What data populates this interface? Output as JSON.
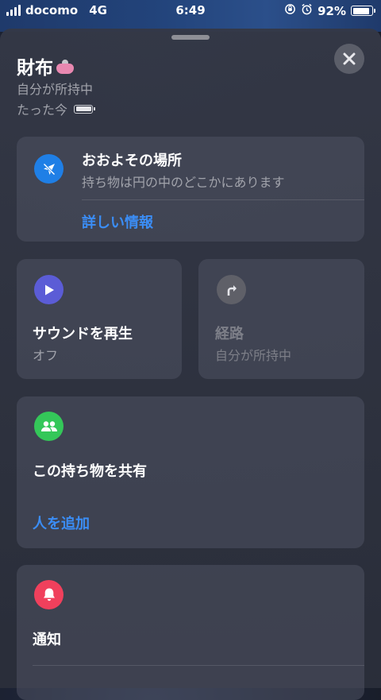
{
  "status_bar": {
    "carrier": "docomo",
    "network": "4G",
    "time": "6:49",
    "battery_percent": "92%",
    "battery_level": 0.92
  },
  "header": {
    "title": "財布",
    "subtitle": "自分が所持中",
    "updated": "たった今"
  },
  "location_card": {
    "title": "おおよその場所",
    "description": "持ち物は円の中のどこかにあります",
    "link": "詳しい情報"
  },
  "sound_card": {
    "title": "サウンドを再生",
    "status": "オフ"
  },
  "directions_card": {
    "title": "経路",
    "status": "自分が所持中"
  },
  "share_card": {
    "title": "この持ち物を共有",
    "link": "人を追加"
  },
  "notify_card": {
    "title": "通知"
  },
  "colors": {
    "accent": "#3b8df5",
    "location_icon": "#1f7fe6",
    "sound_icon": "#5b5cd6",
    "share_icon": "#34c759",
    "notify_icon": "#f0405c"
  }
}
